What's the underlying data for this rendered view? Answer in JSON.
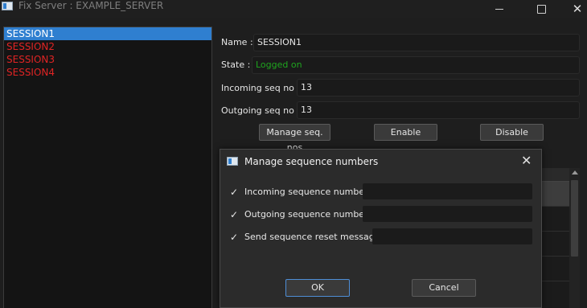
{
  "window": {
    "title": "Fix Server : EXAMPLE_SERVER",
    "min_glyph": "",
    "max_glyph": "",
    "close_glyph": "✕"
  },
  "sessions": [
    {
      "label": "SESSION1",
      "selected": true,
      "color": "#ffffff"
    },
    {
      "label": "SESSION2",
      "selected": false,
      "color": "#e02424"
    },
    {
      "label": "SESSION3",
      "selected": false,
      "color": "#e02424"
    },
    {
      "label": "SESSION4",
      "selected": false,
      "color": "#e02424"
    }
  ],
  "details": {
    "name_label": "Name :",
    "name_value": "SESSION1",
    "state_label": "State :",
    "state_value": "Logged on",
    "state_color": "#1fa51f",
    "incoming_label": "Incoming seq no :",
    "incoming_value": "13",
    "outgoing_label": "Outgoing seq no :",
    "outgoing_value": "13"
  },
  "buttons": {
    "manage": "Manage seq. nos",
    "enable": "Enable",
    "disable": "Disable"
  },
  "dialog": {
    "title": "Manage sequence numbers",
    "close_glyph": "✕",
    "check_glyph": "✓",
    "rows": [
      {
        "label": "Incoming sequence number",
        "checked": true,
        "value": ""
      },
      {
        "label": "Outgoing sequence number",
        "checked": true,
        "value": ""
      },
      {
        "label": "Send sequence reset message",
        "checked": true,
        "value": ""
      }
    ],
    "ok": "OK",
    "cancel": "Cancel"
  },
  "colors": {
    "accent": "#2f7fd0",
    "error_session": "#e02424",
    "background": "#1e1e1e"
  }
}
